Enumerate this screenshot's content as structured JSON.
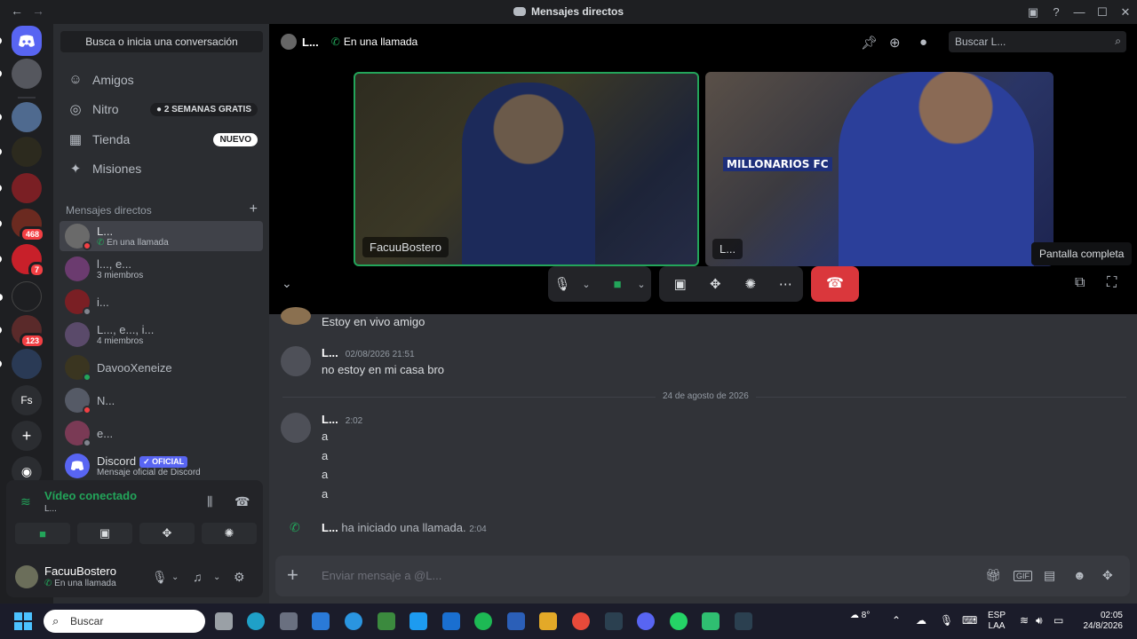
{
  "titlebar": {
    "title": "Mensajes directos"
  },
  "servers": [
    {
      "label": "",
      "badge": ""
    },
    {
      "label": "",
      "badge": ""
    },
    {
      "label": "",
      "badge": ""
    },
    {
      "label": "",
      "badge": ""
    },
    {
      "label": "",
      "badge": "468"
    },
    {
      "label": "",
      "badge": "7"
    },
    {
      "label": "",
      "badge": ""
    },
    {
      "label": "",
      "badge": "123"
    },
    {
      "label": "",
      "badge": ""
    },
    {
      "label": "Fs",
      "badge": ""
    }
  ],
  "sidebar": {
    "search_label": "Busca o inicia una conversación",
    "nav": [
      {
        "label": "Amigos",
        "tag": ""
      },
      {
        "label": "Nitro",
        "tag": "2 SEMANAS GRATIS"
      },
      {
        "label": "Tienda",
        "tag": "NUEVO"
      },
      {
        "label": "Misiones",
        "tag": ""
      }
    ],
    "dm_header": "Mensajes directos",
    "dms": [
      {
        "name": "L...",
        "sub": "En una llamada"
      },
      {
        "name": "l..., e...",
        "sub": "3 miembros"
      },
      {
        "name": "i...",
        "sub": ""
      },
      {
        "name": "L..., e..., i...",
        "sub": "4 miembros"
      },
      {
        "name": "DavooXeneize",
        "sub": ""
      },
      {
        "name": "N...",
        "sub": ""
      },
      {
        "name": "e...",
        "sub": ""
      },
      {
        "name": "Discord",
        "sub": "Mensaje oficial de Discord",
        "badge": "✓ OFICIAL"
      }
    ]
  },
  "voice": {
    "title": "Vídeo conectado",
    "channel": "L..."
  },
  "user": {
    "name": "FacuuBostero",
    "status": "En una llamada"
  },
  "channel": {
    "name": "L...",
    "status": "En una llamada",
    "search_placeholder": "Buscar L..."
  },
  "call": {
    "tile_a_label": "FacuuBostero",
    "tile_b_label": "L...",
    "jersey_text": "MILLONARIOS FC",
    "tooltip": "Pantalla completa"
  },
  "messages": {
    "first_line": "Estoy en vivo amigo",
    "m2_author": "L...",
    "m2_time": "02/08/2026 21:51",
    "m2_line": "no estoy en mi casa bro",
    "date_divider": "24 de agosto de 2026",
    "m3_author": "L...",
    "m3_time": "2:02",
    "m3_lines": [
      "a",
      "a",
      "a",
      "a"
    ],
    "sys_author": "L...",
    "sys_text": " ha iniciado una llamada.",
    "sys_time": "2:04"
  },
  "composer": {
    "placeholder": "Enviar mensaje a @L..."
  },
  "taskbar": {
    "search_label": "Buscar",
    "weather": "8°",
    "lang_top": "ESP",
    "lang_bottom": "LAA",
    "time": "02:05",
    "date": "24/8/2026"
  },
  "colors": {
    "accent": "#5865f2",
    "green": "#23a55a",
    "hangup": "#da373c"
  }
}
